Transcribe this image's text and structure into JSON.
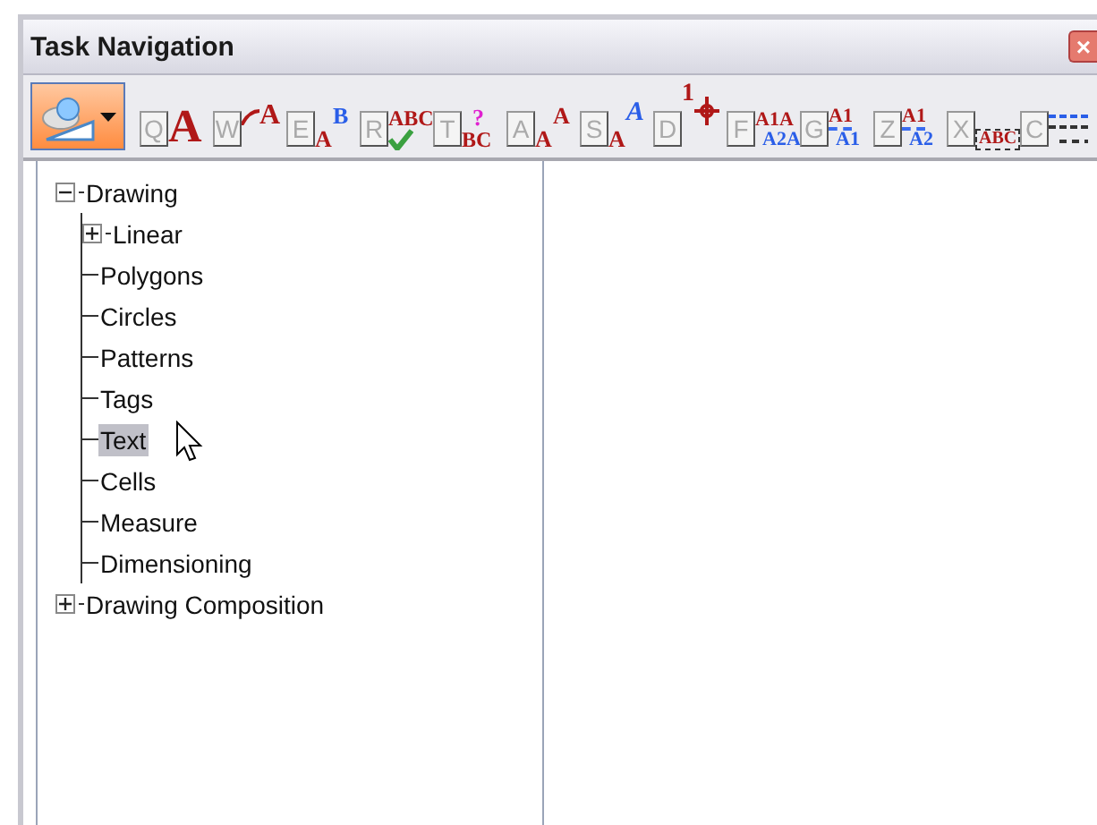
{
  "window": {
    "title": "Task Navigation",
    "close": "×"
  },
  "toolbar": {
    "main_button": {
      "selected": true
    },
    "tools": [
      {
        "key": "Q",
        "kind": "big",
        "texts": [
          "A"
        ]
      },
      {
        "key": "W",
        "kind": "line",
        "texts": [
          "A"
        ]
      },
      {
        "key": "E",
        "kind": "raise",
        "texts": [
          "B",
          "A"
        ]
      },
      {
        "key": "R",
        "kind": "check",
        "texts": [
          "ABC"
        ]
      },
      {
        "key": "T",
        "kind": "query",
        "texts": [
          "?",
          "BC"
        ]
      },
      {
        "key": "A",
        "kind": "raise",
        "texts": [
          "A",
          "A"
        ]
      },
      {
        "key": "S",
        "kind": "script",
        "texts": [
          "A",
          "A"
        ]
      },
      {
        "key": "D",
        "kind": "point",
        "texts": [
          "1"
        ]
      },
      {
        "key": "F",
        "kind": "pair",
        "texts": [
          "A1A",
          "A2A"
        ]
      },
      {
        "key": "G",
        "kind": "pair",
        "texts": [
          "A1",
          "A1"
        ]
      },
      {
        "key": "Z",
        "kind": "pair",
        "texts": [
          "A1",
          "A2"
        ]
      },
      {
        "key": "X",
        "kind": "dotted",
        "texts": [
          "ABC"
        ]
      },
      {
        "key": "C",
        "kind": "dashes"
      }
    ]
  },
  "tree": [
    {
      "label": "Drawing",
      "kind": "folder",
      "expanded": true,
      "selected": false,
      "children": [
        {
          "label": "Linear",
          "kind": "folder",
          "expanded": false,
          "selected": false
        },
        {
          "label": "Polygons",
          "kind": "leaf",
          "selected": false
        },
        {
          "label": "Circles",
          "kind": "leaf",
          "selected": false
        },
        {
          "label": "Patterns",
          "kind": "leaf",
          "selected": false
        },
        {
          "label": "Tags",
          "kind": "leaf",
          "selected": false
        },
        {
          "label": "Text",
          "kind": "leaf",
          "selected": true
        },
        {
          "label": "Cells",
          "kind": "leaf",
          "selected": false
        },
        {
          "label": "Measure",
          "kind": "leaf",
          "selected": false
        },
        {
          "label": "Dimensioning",
          "kind": "leaf",
          "selected": false
        }
      ]
    },
    {
      "label": "Drawing Composition",
      "kind": "folder",
      "expanded": false,
      "selected": false
    }
  ]
}
